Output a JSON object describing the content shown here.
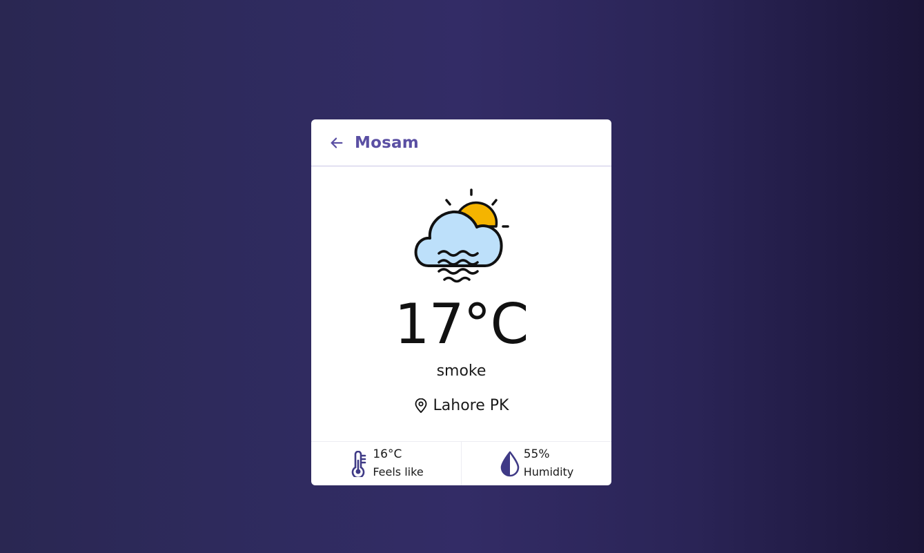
{
  "header": {
    "back_icon": "arrow-left-icon",
    "title": "Mosam"
  },
  "weather": {
    "icon": "cloud-sun-fog-icon",
    "temperature": "17°C",
    "condition": "smoke",
    "location_icon": "map-pin-icon",
    "location": "Lahore PK"
  },
  "stats": {
    "feels_like": {
      "icon": "thermometer-icon",
      "value": "16°C",
      "label": "Feels like"
    },
    "humidity": {
      "icon": "water-drop-icon",
      "value": "55%",
      "label": "Humidity"
    }
  },
  "colors": {
    "background": "#2f2b5f",
    "accent": "#5a4fa3",
    "card": "#ffffff",
    "sun": "#f5b400",
    "cloud": "#bde0fa"
  }
}
